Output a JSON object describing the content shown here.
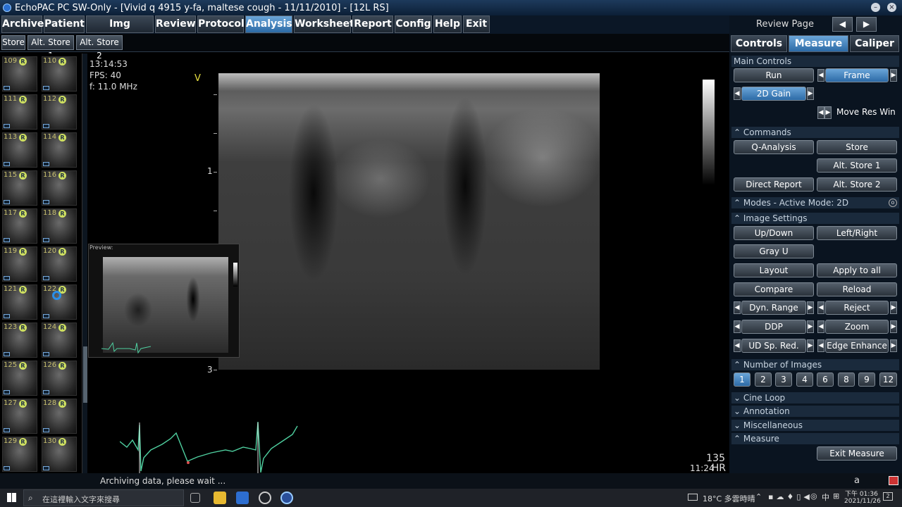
{
  "window": {
    "title": "EchoPAC PC SW-Only - [Vivid q 4915 y-fa, maltese cough - 11/11/2010] - [12L RS]"
  },
  "menu": [
    "Archive",
    "Patient",
    "Img Browser",
    "Review",
    "Protocol",
    "Analysis",
    "Worksheet",
    "Report",
    "Config",
    "Help",
    "Exit"
  ],
  "active_menu": "Analysis",
  "store_buttons": [
    "Store",
    "Alt. Store 1",
    "Alt. Store 2"
  ],
  "review": {
    "label": "Review Page",
    "prev": "◀",
    "next": "▶"
  },
  "thumbnails": [
    "109",
    "110",
    "111",
    "112",
    "113",
    "114",
    "115",
    "116",
    "117",
    "118",
    "119",
    "120",
    "121",
    "122",
    "123",
    "124",
    "125",
    "126",
    "127",
    "128",
    "129",
    "130"
  ],
  "thumb_badge": "R",
  "image_info": {
    "time": "13:14:53",
    "fps": "FPS: 40",
    "freq": "f: 11.0 MHz",
    "marker": "V"
  },
  "depth_labels": [
    "1",
    "3"
  ],
  "preview": {
    "label": "Preview:"
  },
  "heart_rate": {
    "value": "135",
    "time": "11:24",
    "unit": "HR"
  },
  "tabs": [
    "Controls",
    "Measure",
    "Caliper"
  ],
  "active_tab": "Measure",
  "sections": {
    "main_controls": "Main Controls",
    "commands": "Commands",
    "modes": "Modes - Active Mode: 2D",
    "image_settings": "Image Settings",
    "number_of_images": "Number of Images",
    "cine_loop": "Cine Loop",
    "annotation": "Annotation",
    "miscellaneous": "Miscellaneous",
    "measure": "Measure"
  },
  "main_controls": {
    "run": "Run",
    "frame": "Frame",
    "gain": "2D Gain",
    "move_res": "Move Res Win"
  },
  "commands": {
    "q_analysis": "Q-Analysis",
    "store": "Store",
    "alt_store1": "Alt. Store 1",
    "direct_report": "Direct Report",
    "alt_store2": "Alt. Store 2"
  },
  "image_settings": {
    "updown": "Up/Down",
    "leftright": "Left/Right",
    "grayu": "Gray U",
    "layout": "Layout",
    "apply_all": "Apply to all",
    "compare": "Compare",
    "reload": "Reload",
    "dyn_range": "Dyn. Range",
    "reject": "Reject",
    "ddp": "DDP",
    "zoom": "Zoom",
    "ud_sp_red": "UD Sp. Red.",
    "edge": "Edge Enhance"
  },
  "number_of_images": [
    "1",
    "2",
    "3",
    "4",
    "6",
    "8",
    "9",
    "12"
  ],
  "selected_images": "1",
  "exit_measure": "Exit Measure",
  "status": {
    "message": "Archiving data, please wait ...",
    "right": "a"
  },
  "taskbar": {
    "search": "在這裡輸入文字來搜尋",
    "weather": "18°C 多雲時晴",
    "time": "下午 01:36",
    "date": "2021/11/26",
    "notif": "2"
  },
  "colors": {
    "accent": "#2c6aa6",
    "ecg": "#4fd0a0"
  }
}
